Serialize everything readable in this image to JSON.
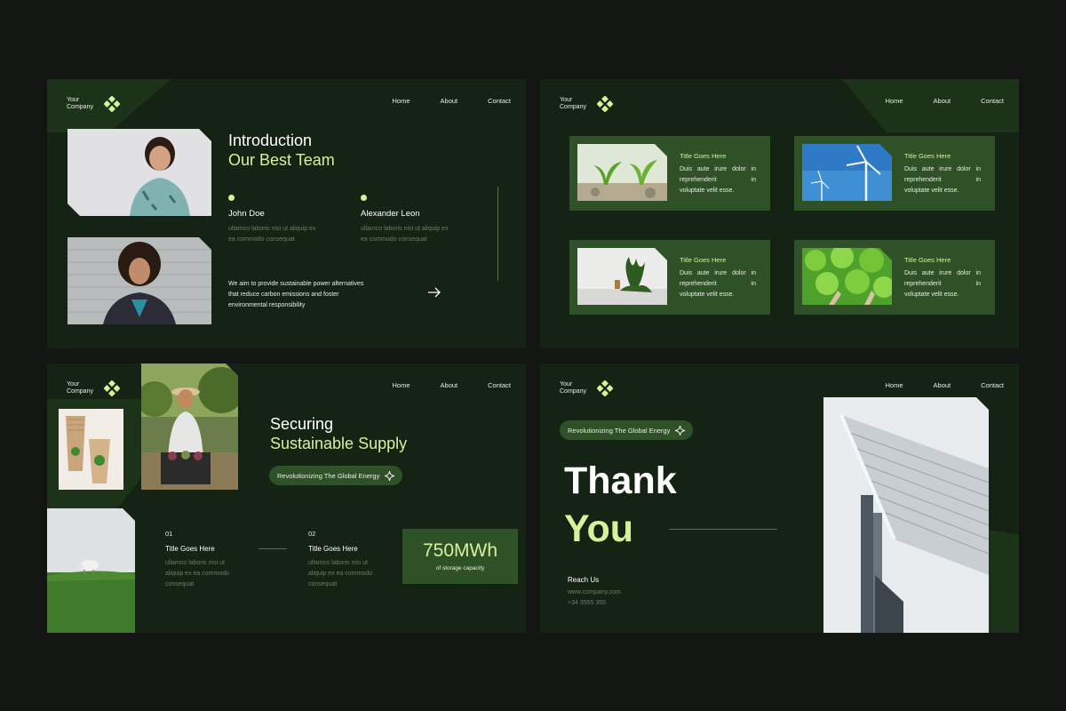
{
  "logo": {
    "line1": "Your",
    "line2": "Company"
  },
  "nav": {
    "home": "Home",
    "about": "About",
    "contact": "Contact"
  },
  "colors": {
    "background": "#131513",
    "slide": "#142313",
    "card": "#2f5127",
    "accent": "#d5f29a",
    "muted": "#6c7f68"
  },
  "slide1": {
    "title_line1": "Introduction",
    "title_line2": "Our Best Team",
    "members": [
      {
        "name": "John Doe",
        "desc_line1": "ullamco laboris nisi ut aliquip ex",
        "desc_line2": "ea commodo consequat"
      },
      {
        "name": "Alexander Leon",
        "desc_line1": "ullamco laboris nisi ut aliquip ex",
        "desc_line2": "ea commodo consequat"
      }
    ],
    "mission_line1": "We aim to provide sustainable power alternatives",
    "mission_line2": "that reduce carbon emissions and foster",
    "mission_line3": "environmental responsibility",
    "arrow_icon": "arrow-right-icon"
  },
  "slide2": {
    "cards": [
      {
        "title": "Title Goes Here",
        "l1": "Duis aute irure dolor in",
        "l2": "reprehenderit in",
        "l3": "voluptate velit esse."
      },
      {
        "title": "Title Goes Here",
        "l1": "Duis aute irure dolor in",
        "l2": "reprehenderit in",
        "l3": "voluptate velit esse."
      },
      {
        "title": "Title Goes Here",
        "l1": "Duis aute irure dolor in",
        "l2": "reprehenderit in",
        "l3": "voluptate velit esse."
      },
      {
        "title": "Title Goes Here",
        "l1": "Duis aute irure dolor in",
        "l2": "reprehenderit in",
        "l3": "voluptate velit esse."
      }
    ]
  },
  "slide3": {
    "title_line1": "Securing",
    "title_line2": "Sustainable Supply",
    "pill": "Revolutionizing The Global Energy",
    "items": [
      {
        "num": "01",
        "title": "Title Goes Here",
        "l1": "ullamco laboris nisi ut",
        "l2": "aliquip ex ea commodo",
        "l3": "consequat"
      },
      {
        "num": "02",
        "title": "Title Goes Here",
        "l1": "ullamco laboris nisi ut",
        "l2": "aliquip ex ea commodo",
        "l3": "consequat"
      }
    ],
    "stat_value": "750MWh",
    "stat_label": "of storage capacity"
  },
  "slide4": {
    "pill": "Revolutionizing The Global Energy",
    "thank": "Thank",
    "you": "You",
    "reach": "Reach Us",
    "website": "www.company.com",
    "phone": "+34 3555 355"
  }
}
